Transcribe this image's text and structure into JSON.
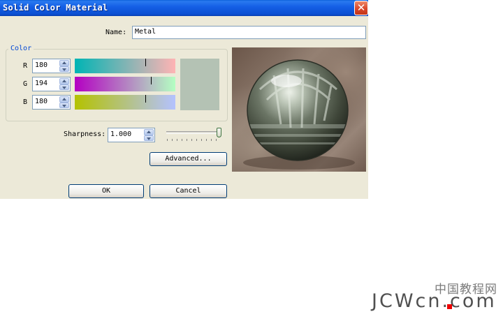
{
  "window": {
    "title": "Solid Color Material",
    "close_glyph": "✕"
  },
  "name_field": {
    "label": "Name:",
    "value": "Metal"
  },
  "color_group": {
    "title": "Color",
    "channels": [
      {
        "label": "R",
        "value": "180",
        "fraction": 0.706
      },
      {
        "label": "G",
        "value": "194",
        "fraction": 0.761
      },
      {
        "label": "B",
        "value": "180",
        "fraction": 0.706
      }
    ],
    "swatch_color": "#b4c2b4"
  },
  "sharpness": {
    "label": "Sharpness:",
    "value": "1.000",
    "fraction": 1.0
  },
  "buttons": {
    "advanced": "Advanced...",
    "ok": "OK",
    "cancel": "Cancel"
  },
  "preview": {
    "subject": "metal-sphere-preview"
  },
  "watermark": {
    "cn": "中国教程网",
    "en": "JCWcn.com"
  },
  "colors": {
    "title_bar": "#0b4fd2",
    "dialog_bg": "#ece9d8",
    "close_button": "#d9472a",
    "group_title": "#0046d5"
  }
}
